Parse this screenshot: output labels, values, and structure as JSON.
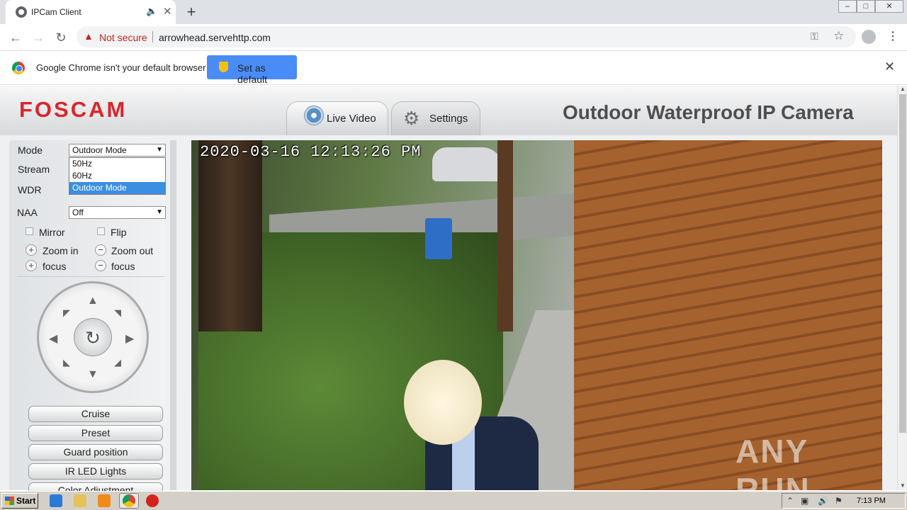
{
  "browser": {
    "tab_title": "IPCam Client",
    "new_tab_symbol": "+",
    "not_secure": "Not secure",
    "url": "arrowhead.servehttp.com",
    "infobar_message": "Google Chrome isn't your default browser",
    "set_default_label": "Set as default",
    "window_controls": [
      "–",
      "□",
      "✕"
    ]
  },
  "app": {
    "logo": "FOSCAM",
    "product_title": "Outdoor Waterproof IP Camera",
    "tabs": [
      {
        "label": "Live Video",
        "active": true
      },
      {
        "label": "Settings",
        "active": false
      }
    ]
  },
  "sidebar": {
    "mode_label": "Mode",
    "mode_value": "Outdoor Mode",
    "mode_options": [
      "50Hz",
      "60Hz",
      "Outdoor Mode"
    ],
    "stream_label": "Stream",
    "wdr_label": "WDR",
    "naa_label": "NAA",
    "naa_value": "Off",
    "mirror_label": "Mirror",
    "flip_label": "Flip",
    "zoom_in_label": "Zoom in",
    "zoom_out_label": "Zoom out",
    "focus_in_label": "focus",
    "focus_out_label": "focus",
    "buttons": [
      "Cruise",
      "Preset",
      "Guard position",
      "IR LED Lights",
      "Color Adjustment"
    ]
  },
  "video": {
    "timestamp": "2020-03-16 12:13:26 PM",
    "watermark": "ANY RUN"
  },
  "taskbar": {
    "start_label": "Start",
    "clock": "7:13 PM"
  },
  "colors": {
    "foscam_red": "#d8262c",
    "chrome_blue": "#4a8cf7",
    "selection_blue": "#3a8fe0",
    "not_secure_red": "#c5221f"
  }
}
